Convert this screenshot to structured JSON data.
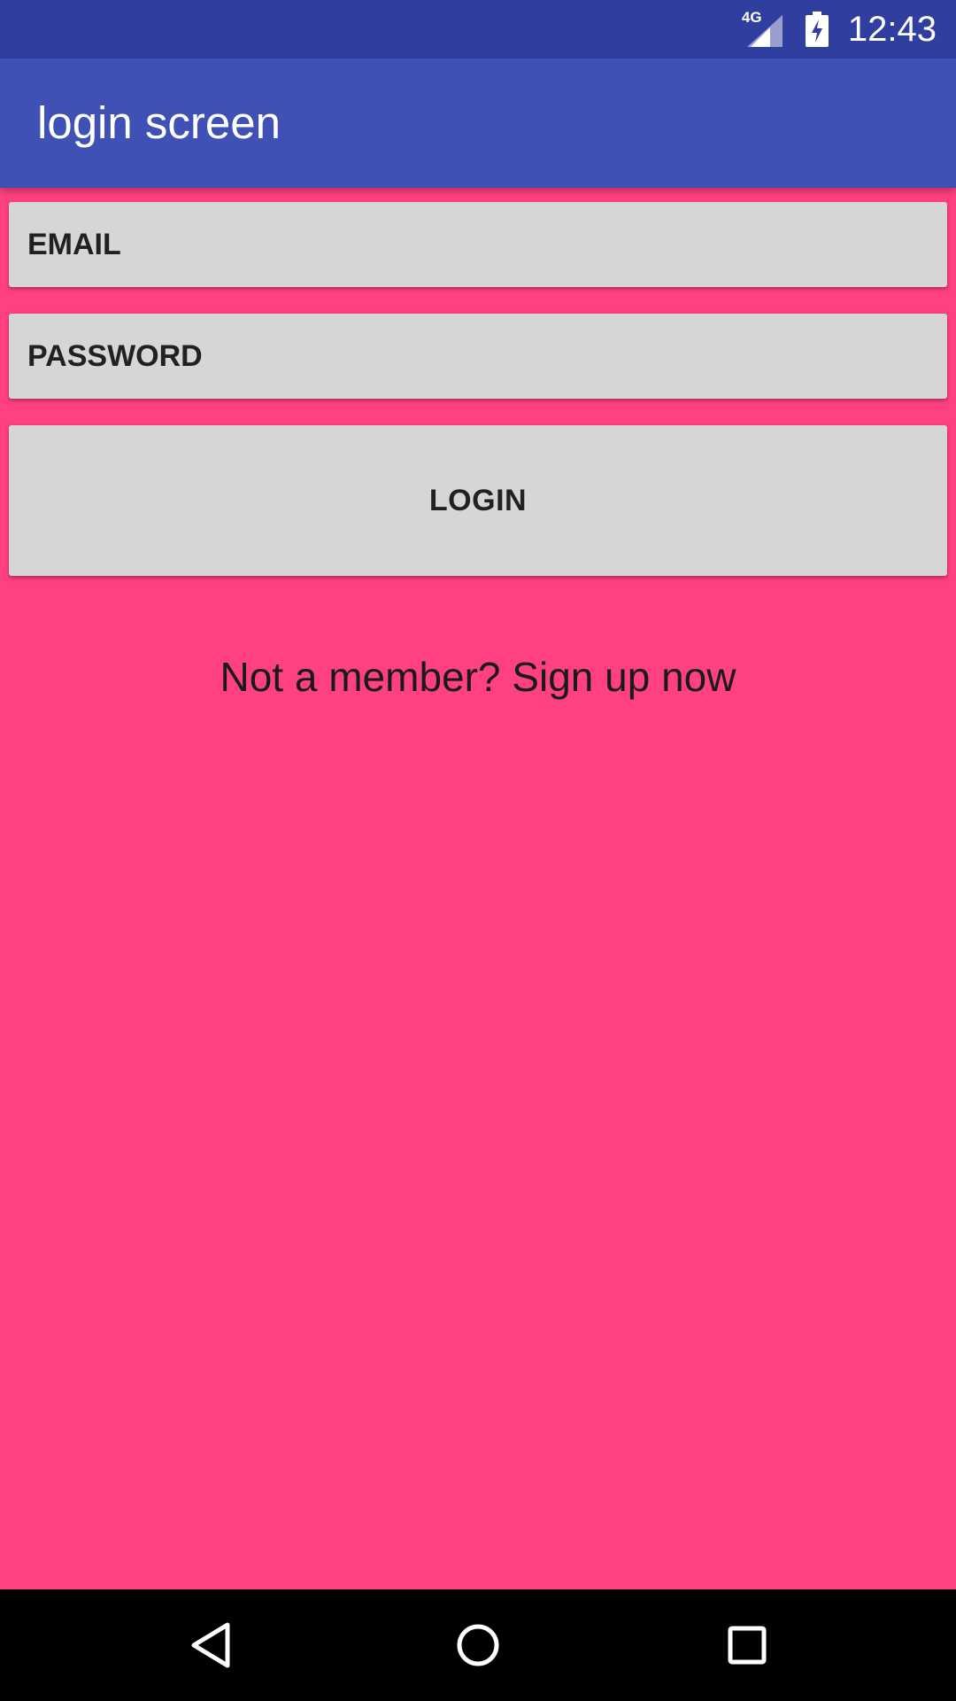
{
  "status_bar": {
    "network_type": "4G",
    "time": "12:43",
    "icons": [
      "signal-icon",
      "battery-charging-icon"
    ]
  },
  "app_bar": {
    "title": "login screen"
  },
  "form": {
    "email_placeholder": "EMAIL",
    "email_value": "",
    "password_placeholder": "PASSWORD",
    "password_value": "",
    "login_label": "LOGIN"
  },
  "signup": {
    "text": "Not a member? Sign up now"
  },
  "nav_bar": {
    "icons": [
      "back-icon",
      "home-icon",
      "recents-icon"
    ]
  },
  "colors": {
    "status_bar": "#303f9f",
    "app_bar": "#3f51b5",
    "background": "#ff4081",
    "field_background": "#d6d6d6",
    "nav_bar": "#000000"
  }
}
